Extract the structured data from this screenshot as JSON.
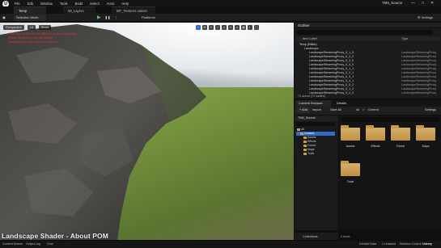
{
  "title_bar": {
    "menu": [
      "File",
      "Edit",
      "Window",
      "Tools",
      "Build",
      "Select",
      "Actor",
      "Help"
    ],
    "app_title": "TM5_Source",
    "window_controls": [
      "—",
      "□",
      "✕"
    ]
  },
  "tabs": [
    "Temp",
    "MI_Layers",
    "MF_Textures.uasset"
  ],
  "toolbar": {
    "mode_label": "Selection Mode",
    "platforms_label": "Platforms",
    "settings_label": "Settings"
  },
  "viewport": {
    "chips": [
      "Perspective",
      "Lit",
      "Show"
    ],
    "warning_lines": [
      "LIGHTING NEEDS TO BE REBUILT (1 unbuilt object(s))",
      "Texture Streaming Pool Over Budget",
      "'DisableAllScreenMessages' to suppress"
    ],
    "caption": "Landscape Shader - About POM"
  },
  "outliner": {
    "title": "Outliner",
    "columns": {
      "item": "Item Label",
      "type": "Type"
    },
    "rows": [
      {
        "label": "Temp (Editor)",
        "type": "",
        "kind": "world",
        "indent": 0
      },
      {
        "label": "Landscape",
        "type": "",
        "kind": "folder",
        "indent": 1
      },
      {
        "label": "LandscapeStreamingProxy_0_1_0",
        "type": "LandscapeStreamingProxy",
        "kind": "actor",
        "indent": 2
      },
      {
        "label": "LandscapeStreamingProxy_0_2_0",
        "type": "LandscapeStreamingProxy",
        "kind": "actor",
        "indent": 2
      },
      {
        "label": "LandscapeStreamingProxy_0_3_0",
        "type": "LandscapeStreamingProxy",
        "kind": "actor",
        "indent": 2
      },
      {
        "label": "LandscapeStreamingProxy_0_4_0",
        "type": "LandscapeStreamingProxy",
        "kind": "actor",
        "indent": 2
      },
      {
        "label": "LandscapeStreamingProxy_0_1_1",
        "type": "LandscapeStreamingProxy",
        "kind": "actor",
        "indent": 2
      },
      {
        "label": "LandscapeStreamingProxy_0_2_1",
        "type": "LandscapeStreamingProxy",
        "kind": "actor",
        "indent": 2
      },
      {
        "label": "LandscapeStreamingProxy_0_3_1",
        "type": "LandscapeStreamingProxy",
        "kind": "actor",
        "indent": 2
      },
      {
        "label": "LandscapeStreamingProxy_0_4_1",
        "type": "LandscapeStreamingProxy",
        "kind": "actor",
        "indent": 2
      },
      {
        "label": "LandscapeStreamingProxy_0_0_2",
        "type": "LandscapeStreamingProxy",
        "kind": "actor",
        "indent": 2
      },
      {
        "label": "LandscapeStreamingProxy_0_1_2",
        "type": "LandscapeStreamingProxy",
        "kind": "actor",
        "indent": 2
      },
      {
        "label": "LandscapeStreamingProxy_0_2_2",
        "type": "LandscapeStreamingProxy",
        "kind": "actor",
        "indent": 2
      }
    ],
    "footer": "73 actors (73 loaded)"
  },
  "content_browser": {
    "tabs": [
      "Content Browser",
      "Details"
    ],
    "add_label": "+ Add",
    "import_label": "Import",
    "save_all_label": "Save All",
    "path": [
      "All",
      ">",
      "Content"
    ],
    "settings_label": "Settings",
    "tree_title": "TM5_Source",
    "tree": [
      {
        "label": "All",
        "indent": 0,
        "selected": false
      },
      {
        "label": "Content",
        "indent": 1,
        "selected": true
      },
      {
        "label": "Assets",
        "indent": 2,
        "selected": false
      },
      {
        "label": "Effects",
        "indent": 2,
        "selected": false
      },
      {
        "label": "Forest",
        "indent": 2,
        "selected": false
      },
      {
        "label": "Maps",
        "indent": 2,
        "selected": false
      },
      {
        "label": "Tools",
        "indent": 2,
        "selected": false
      }
    ],
    "folders": [
      "Assets",
      "Effects",
      "Forest",
      "Maps",
      "Tools"
    ],
    "item_count": "5 items",
    "collections_label": "Collections"
  },
  "status_bar": {
    "content_drawer": "Content Drawer",
    "output_log": "Output Log",
    "cmd": "Cmd",
    "derived_data": "Derived Data",
    "unsaved": "1 Unsaved",
    "revision_control": "Revision Control",
    "watermark": "Udemy"
  },
  "colors": {
    "selection_blue": "#2f6cc9",
    "folder": "#c79a48",
    "play_green": "#5ec05a"
  }
}
